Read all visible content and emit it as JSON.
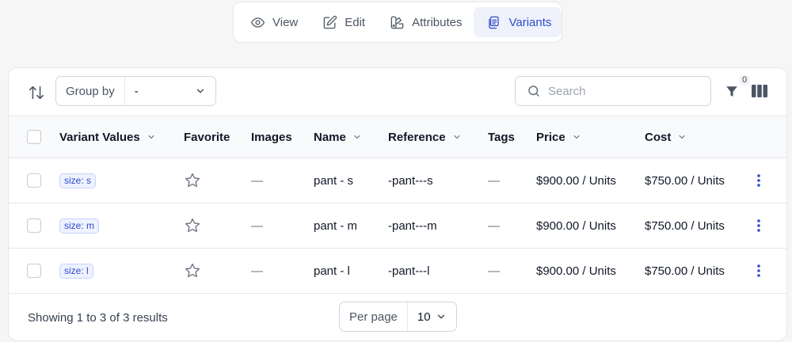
{
  "tabs": [
    {
      "label": "View",
      "icon": "eye-icon",
      "active": false
    },
    {
      "label": "Edit",
      "icon": "pencil-square-icon",
      "active": false
    },
    {
      "label": "Attributes",
      "icon": "swatch-icon",
      "active": false
    },
    {
      "label": "Variants",
      "icon": "clipboard-document-list-icon",
      "active": true
    }
  ],
  "toolbar": {
    "group_by_label": "Group by",
    "group_by_value": "-",
    "search_placeholder": "Search",
    "filter_count": "0"
  },
  "table": {
    "columns": [
      "Variant Values",
      "Favorite",
      "Images",
      "Name",
      "Reference",
      "Tags",
      "Price",
      "Cost"
    ],
    "rows": [
      {
        "variant": "size: s",
        "images": "—",
        "name": "pant - s",
        "reference": "-pant---s",
        "tags": "—",
        "price": "$900.00 / Units",
        "cost": "$750.00 / Units"
      },
      {
        "variant": "size: m",
        "images": "—",
        "name": "pant - m",
        "reference": "-pant---m",
        "tags": "—",
        "price": "$900.00 / Units",
        "cost": "$750.00 / Units"
      },
      {
        "variant": "size: l",
        "images": "—",
        "name": "pant - l",
        "reference": "-pant---l",
        "tags": "—",
        "price": "$900.00 / Units",
        "cost": "$750.00 / Units"
      }
    ]
  },
  "footer": {
    "showing": "Showing 1 to 3 of 3 results",
    "per_page_label": "Per page",
    "per_page_value": "10"
  },
  "colors": {
    "accent": "#2f4bc9",
    "accent_bg": "#eff2fb",
    "border": "#e5e7eb",
    "page_bg": "#f6f6f7"
  }
}
